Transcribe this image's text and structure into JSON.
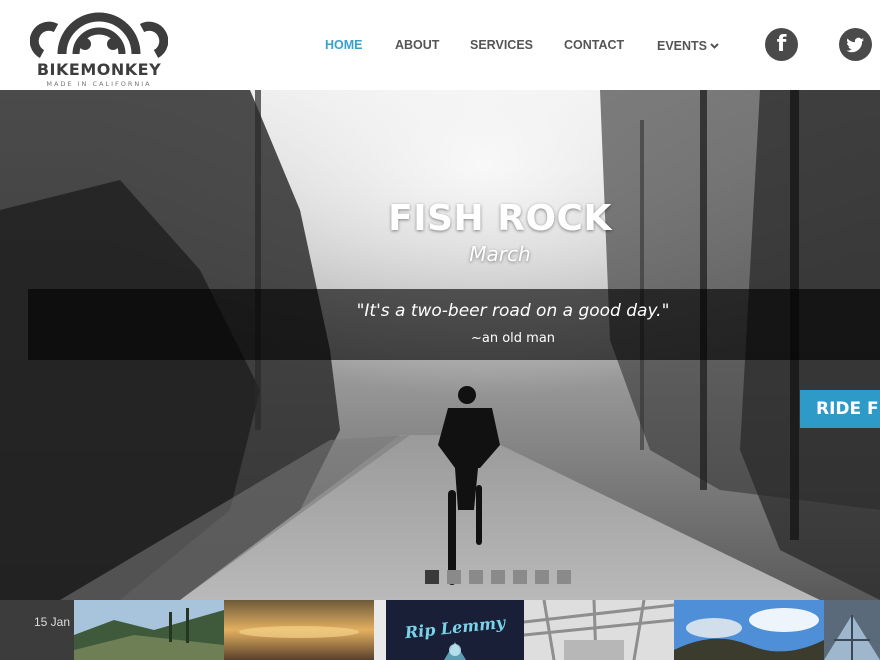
{
  "brand": {
    "name": "BIKEMONKEY",
    "tagline": "MADE IN CALIFORNIA"
  },
  "nav": {
    "items": [
      {
        "label": "HOME",
        "active": true
      },
      {
        "label": "ABOUT",
        "active": false
      },
      {
        "label": "SERVICES",
        "active": false
      },
      {
        "label": "CONTACT",
        "active": false
      },
      {
        "label": "EVENTS",
        "active": false,
        "has_dropdown": true
      }
    ],
    "social": [
      {
        "icon": "facebook-icon",
        "glyph": "f"
      },
      {
        "icon": "twitter-icon"
      }
    ]
  },
  "hero": {
    "title": "FISH ROCK",
    "subtitle": "March",
    "quote": "\"It's a two-beer road on a good day.\"",
    "quote_author": "~an old man",
    "cta_label": "RIDE FIS",
    "slides_total": 7,
    "active_slide": 1
  },
  "instagram": {
    "date": "15 Jan",
    "thumbnails": [
      {
        "icon": "forest-hillside-photo"
      },
      {
        "icon": "sunset-clouds-photo"
      },
      {
        "icon": "rip-lemmy-poster",
        "text": "Rip Lemmy"
      },
      {
        "icon": "warehouse-interior-photo"
      },
      {
        "icon": "blue-sky-trees-photo"
      },
      {
        "icon": "glass-dome-photo"
      }
    ]
  },
  "colors": {
    "accent": "#3aa0cc",
    "cta": "#2e9ac8",
    "nav_text": "#555555",
    "social_bg": "#4a4a4a"
  }
}
